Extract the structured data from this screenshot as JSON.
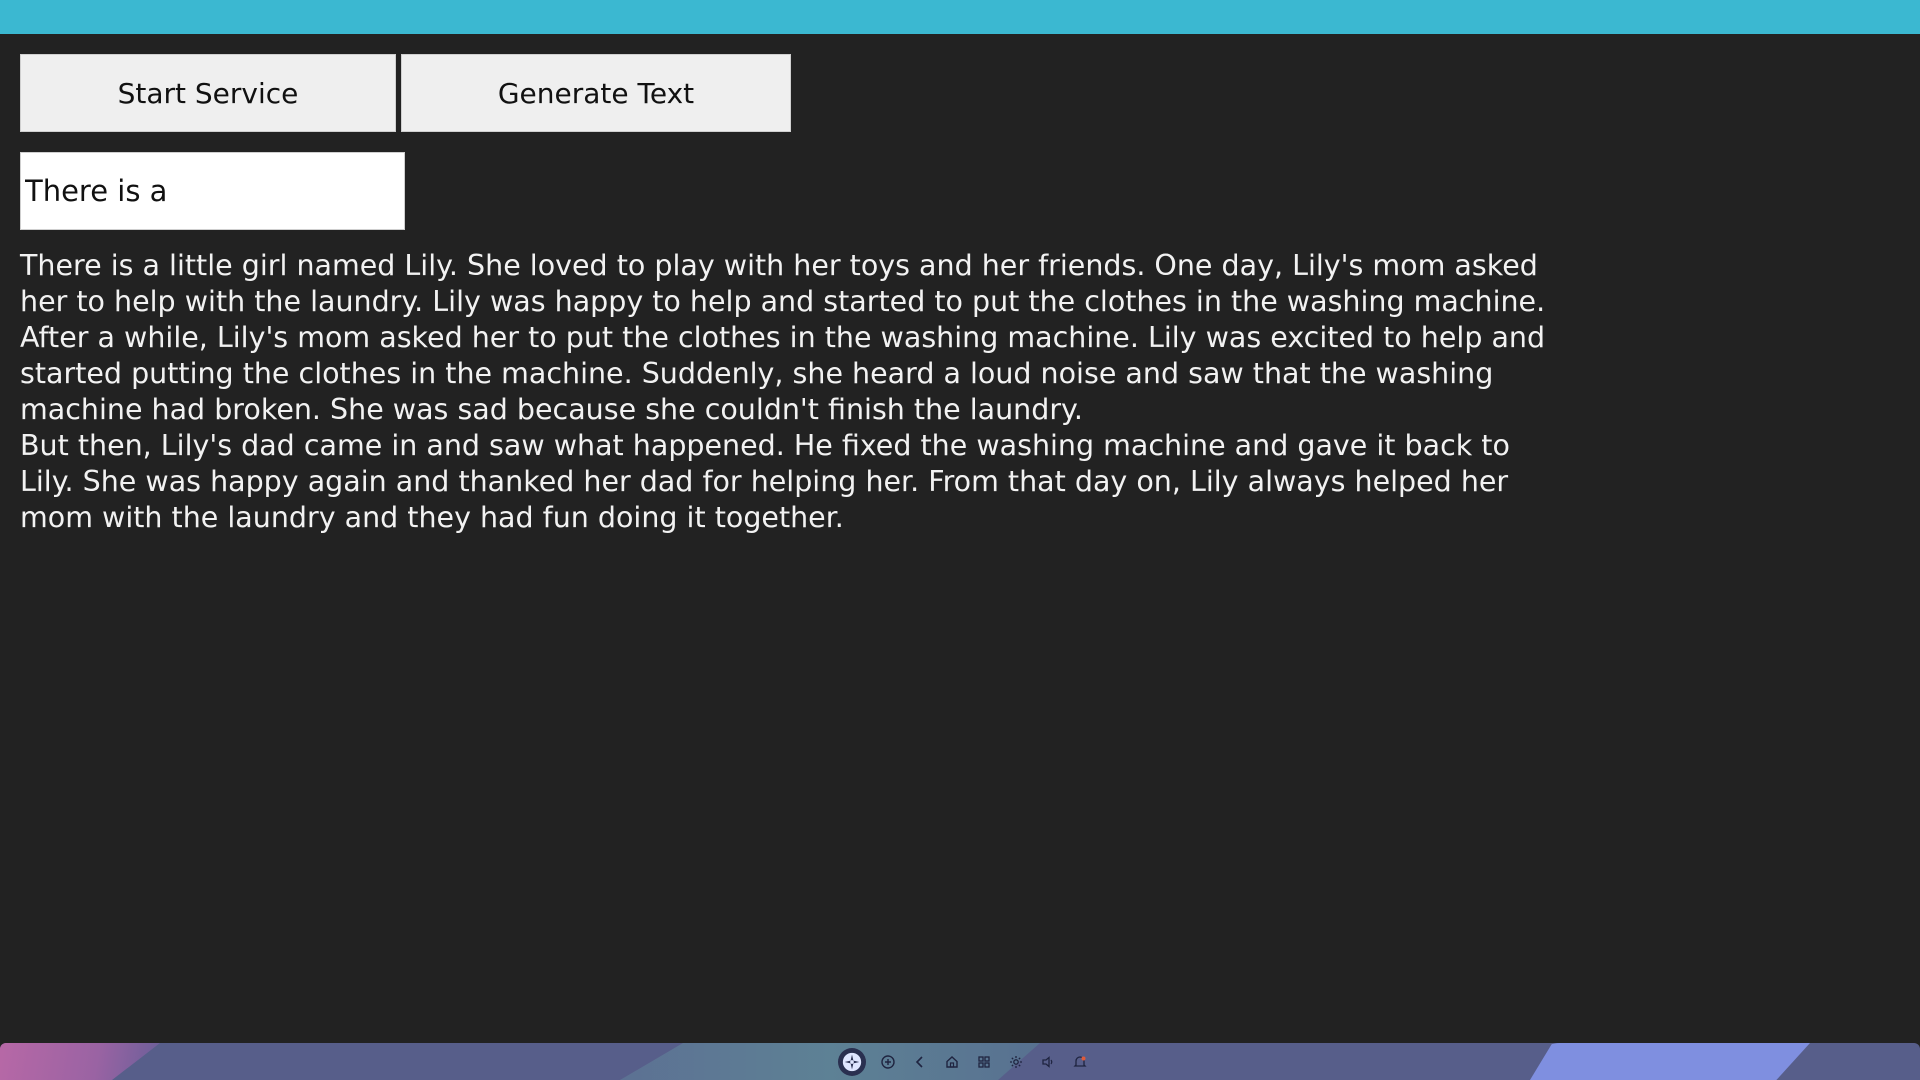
{
  "buttons": {
    "start_service": "Start Service",
    "generate_text": "Generate Text"
  },
  "prompt": {
    "value": "There is a"
  },
  "output": {
    "paragraphs": [
      "There is a little girl named Lily. She loved to play with her toys and her friends. One day, Lily's mom asked her to help with the laundry. Lily was happy to help and started to put the clothes in the washing machine.",
      "After a while, Lily's mom asked her to put the clothes in the washing machine. Lily was excited to help and started putting the clothes in the machine. Suddenly, she heard a loud noise and saw that the washing machine had broken. She was sad because she couldn't finish the laundry.",
      "But then, Lily's dad came in and saw what happened. He fixed the washing machine and gave it back to Lily. She was happy again and thanked her dad for helping her. From that day on, Lily always helped her mom with the laundry and they had fun doing it together."
    ]
  },
  "dock": {
    "icons": [
      "launcher-icon",
      "add-icon",
      "back-icon",
      "home-icon",
      "apps-icon",
      "settings-icon",
      "volume-icon",
      "notification-icon"
    ]
  },
  "colors": {
    "top_bar": "#3bb8d1",
    "background": "#222222",
    "button_bg": "#efefef",
    "text": "#f2f2f2"
  }
}
